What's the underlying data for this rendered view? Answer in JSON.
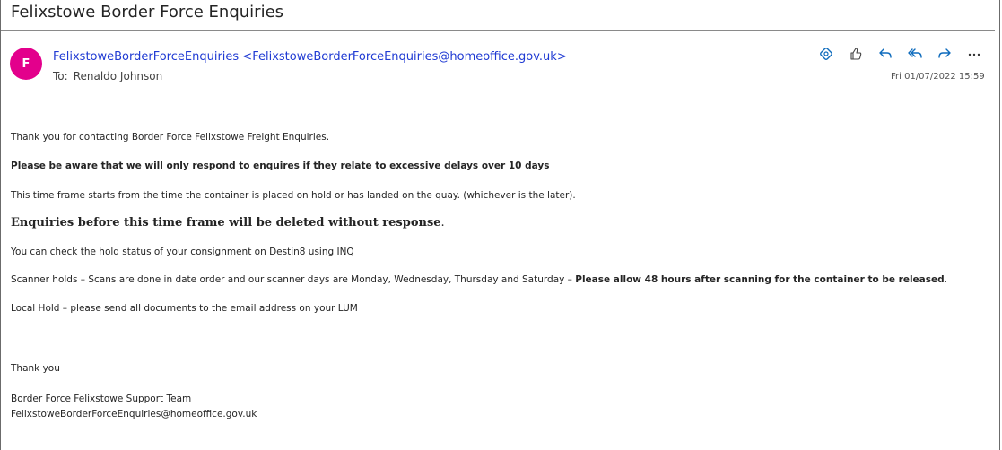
{
  "subject": "Felixstowe Border Force Enquiries",
  "sender": {
    "initial": "F",
    "avatar_color": "#e3008c",
    "display": "FelixstoweBorderForceEnquiries <FelixstoweBorderForceEnquiries@homeoffice.gov.uk>"
  },
  "recipient": {
    "label": "To:",
    "name": "Renaldo Johnson"
  },
  "date": "Fri 01/07/2022 15:59",
  "actions": [
    {
      "name": "loop-icon"
    },
    {
      "name": "like-icon"
    },
    {
      "name": "reply-icon"
    },
    {
      "name": "reply-all-icon"
    },
    {
      "name": "forward-icon"
    },
    {
      "name": "more-icon"
    }
  ],
  "body": {
    "line1": "Thank you for contacting Border Force Felixstowe Freight Enquiries.",
    "line2": "Please be aware that we will only respond to enquires if they relate to excessive delays over 10 days",
    "line3": "This time frame starts from the time the container is placed on hold or has landed on the quay. (whichever is the later).",
    "line4": "Enquiries before this time frame will be deleted without response",
    "line4_end": ".",
    "line5": "You can check the hold status of your consignment on Destin8 using INQ",
    "line6_a": "Scanner holds – Scans are done in date order and our scanner days are Monday, Wednesday, Thursday and Saturday – ",
    "line6_b": "Please allow 48 hours after scanning for the container to be released",
    "line6_c": ".",
    "line7": "Local Hold – please send all documents to the email address on your LUM",
    "sign1": "Thank you",
    "sign2": "Border Force Felixstowe Support Team",
    "sign3": "FelixstoweBorderForceEnquiries@homeoffice.gov.uk"
  },
  "colors": {
    "link_blue": "#1f3ad3",
    "icon_blue": "#0f6cbd"
  }
}
